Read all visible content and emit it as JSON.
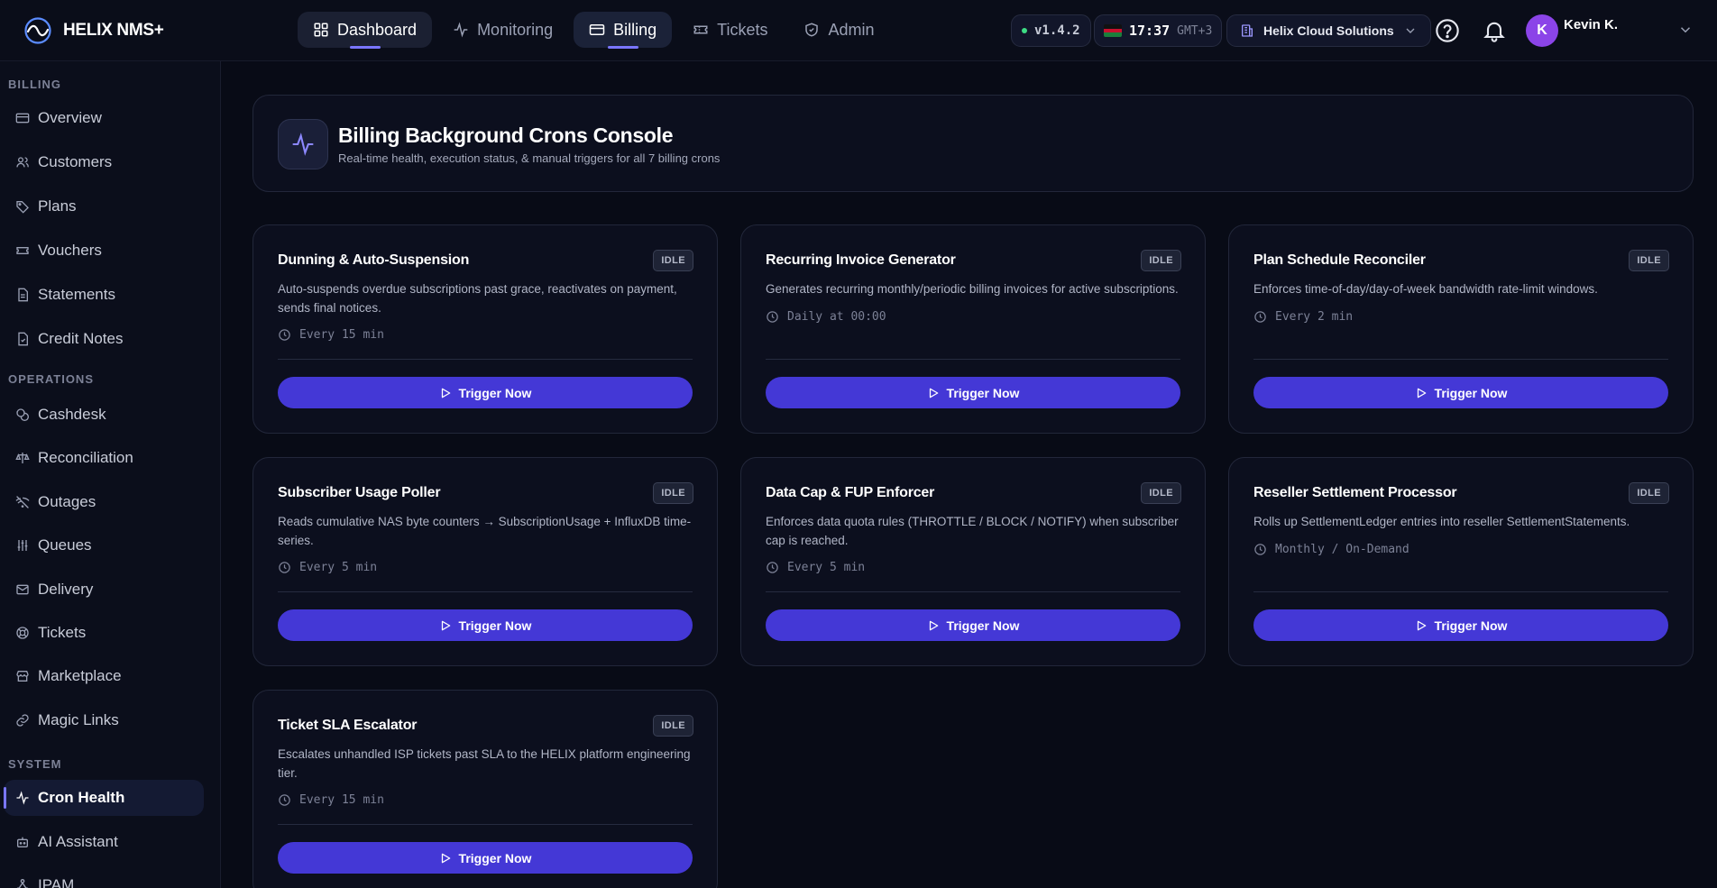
{
  "app": {
    "name": "HELIX NMS+"
  },
  "nav": [
    {
      "label": "Dashboard",
      "icon": "grid-icon",
      "active": true
    },
    {
      "label": "Monitoring",
      "icon": "activity-icon",
      "active": false
    },
    {
      "label": "Billing",
      "icon": "card-icon",
      "active": true
    },
    {
      "label": "Tickets",
      "icon": "ticket-icon",
      "active": false
    },
    {
      "label": "Admin",
      "icon": "shield-icon",
      "active": false
    }
  ],
  "status": {
    "version": "v1.4.2",
    "status_color": "#3ddc84"
  },
  "clock": {
    "time": "17:37",
    "timezone": "GMT+3",
    "flag_icon": "kenya-flag-icon"
  },
  "org": {
    "name": "Helix Cloud Solutions"
  },
  "user": {
    "initial": "K",
    "name": "Kevin K.",
    "avatar_color": "#8b44e8"
  },
  "sidebar": {
    "sections": [
      {
        "label": "BILLING",
        "items": [
          {
            "label": "Overview",
            "icon": "card-icon"
          },
          {
            "label": "Customers",
            "icon": "users-icon"
          },
          {
            "label": "Plans",
            "icon": "tag-icon"
          },
          {
            "label": "Vouchers",
            "icon": "ticket-icon"
          },
          {
            "label": "Statements",
            "icon": "document-icon"
          },
          {
            "label": "Credit Notes",
            "icon": "credit-note-icon"
          }
        ]
      },
      {
        "label": "OPERATIONS",
        "items": [
          {
            "label": "Cashdesk",
            "icon": "coins-icon"
          },
          {
            "label": "Reconciliation",
            "icon": "scale-icon"
          },
          {
            "label": "Outages",
            "icon": "wifi-off-icon"
          },
          {
            "label": "Queues",
            "icon": "sliders-icon"
          },
          {
            "label": "Delivery",
            "icon": "mail-icon"
          },
          {
            "label": "Tickets",
            "icon": "lifebuoy-icon"
          },
          {
            "label": "Marketplace",
            "icon": "store-icon"
          },
          {
            "label": "Magic Links",
            "icon": "link-icon"
          }
        ]
      },
      {
        "label": "SYSTEM",
        "items": [
          {
            "label": "Cron Health",
            "icon": "activity-icon",
            "active": true
          },
          {
            "label": "AI Assistant",
            "icon": "bot-icon"
          },
          {
            "label": "IPAM",
            "icon": "network-icon"
          }
        ]
      }
    ]
  },
  "page": {
    "title": "Billing Background Crons Console",
    "subtitle": "Real-time health, execution status, & manual triggers for all 7 billing crons"
  },
  "crons": [
    {
      "name": "Dunning & Auto-Suspension",
      "status": "IDLE",
      "description": "Auto-suspends overdue subscriptions past grace, reactivates on payment, sends final notices.",
      "schedule": "Every 15 min",
      "action": "Trigger Now"
    },
    {
      "name": "Recurring Invoice Generator",
      "status": "IDLE",
      "description": "Generates recurring monthly/periodic billing invoices for active subscriptions.",
      "schedule": "Daily at 00:00",
      "action": "Trigger Now"
    },
    {
      "name": "Plan Schedule Reconciler",
      "status": "IDLE",
      "description": "Enforces time-of-day/day-of-week bandwidth rate-limit windows.",
      "schedule": "Every 2 min",
      "action": "Trigger Now"
    },
    {
      "name": "Subscriber Usage Poller",
      "status": "IDLE",
      "description": "Reads cumulative NAS byte counters → SubscriptionUsage + InfluxDB time-series.",
      "schedule": "Every 5 min",
      "action": "Trigger Now"
    },
    {
      "name": "Data Cap & FUP Enforcer",
      "status": "IDLE",
      "description": "Enforces data quota rules (THROTTLE / BLOCK / NOTIFY) when subscriber cap is reached.",
      "schedule": "Every 5 min",
      "action": "Trigger Now"
    },
    {
      "name": "Reseller Settlement Processor",
      "status": "IDLE",
      "description": "Rolls up SettlementLedger entries into reseller SettlementStatements.",
      "schedule": "Monthly / On-Demand",
      "action": "Trigger Now"
    },
    {
      "name": "Ticket SLA Escalator",
      "status": "IDLE",
      "description": "Escalates unhandled ISP tickets past SLA to the HELIX platform engineering tier.",
      "schedule": "Every 15 min",
      "action": "Trigger Now"
    }
  ],
  "colors": {
    "accent": "#4438d6",
    "background": "#080b16"
  }
}
